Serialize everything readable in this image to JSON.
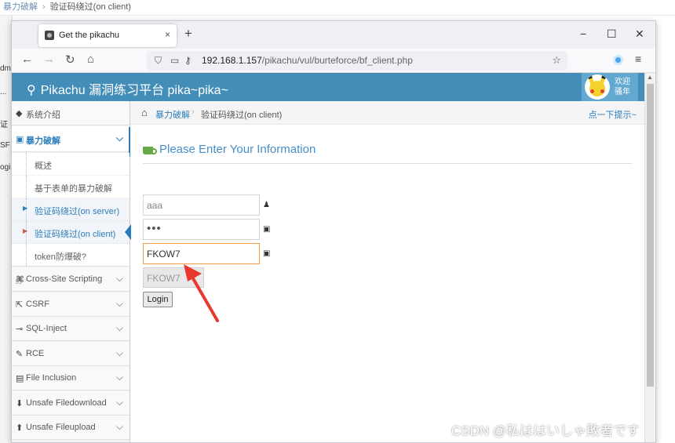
{
  "background_app": {
    "crumb_link": "暴力破解",
    "crumb_current": "验证码绕过(on client)",
    "left_fragments": [
      "dm",
      "...",
      "证",
      "SF",
      "ogi"
    ]
  },
  "browser": {
    "tab_title": "Get the pikachu",
    "tab_close": "×",
    "new_tab": "+",
    "window_controls": {
      "minimize": "−",
      "maximize": "☐",
      "close": "✕"
    },
    "nav": {
      "back": "←",
      "forward": "→",
      "reload": "↻",
      "home": "⌂"
    },
    "url_host": "192.168.1.157",
    "url_path": "/pikachu/vul/burteforce/bf_client.php",
    "star": "☆",
    "menu": "≡"
  },
  "page": {
    "brand": "Pikachu 漏洞练习平台 pika~pika~",
    "user_line1": "欢迎",
    "user_line2": "骚年",
    "sidebar": {
      "items": [
        {
          "icon": "tag-icon",
          "glyph": "🏷",
          "label": "系统介绍"
        },
        {
          "icon": "lock-icon",
          "glyph": "🔒",
          "label": "暴力破解",
          "chev": "⌵"
        },
        {
          "icon": "code-icon",
          "glyph": "⌘",
          "label": "Cross-Site Scripting",
          "chev": "⌵"
        },
        {
          "icon": "share-icon",
          "glyph": "⇱",
          "label": "CSRF",
          "chev": "⌵"
        },
        {
          "icon": "syringe-icon",
          "glyph": "⊸",
          "label": "SQL-Inject",
          "chev": "⌵"
        },
        {
          "icon": "pencil-icon",
          "glyph": "✎",
          "label": "RCE",
          "chev": "⌵"
        },
        {
          "icon": "file-icon",
          "glyph": "▤",
          "label": "File Inclusion",
          "chev": "⌵"
        },
        {
          "icon": "download-icon",
          "glyph": "⬇",
          "label": "Unsafe Filedownload",
          "chev": "⌵"
        },
        {
          "icon": "upload-icon",
          "glyph": "⬆",
          "label": "Unsafe Fileupload",
          "chev": "⌵"
        }
      ],
      "subitems": [
        "概述",
        "基于表单的暴力破解",
        "验证码绕过(on server)",
        "验证码绕过(on client)",
        "token防爆破?"
      ]
    },
    "breadcrumb": {
      "home_glyph": "⌂",
      "link": "暴力破解",
      "sep": "›",
      "current": "验证码绕过(on client)",
      "tip": "点一下提示~"
    },
    "form": {
      "title": "Please Enter Your Information",
      "username_value": "aaa",
      "password_value": "•••",
      "captcha_input_value": "FKOW7",
      "captcha_display": "FKOW7",
      "login_label": "Login",
      "user_glyph": "👤",
      "lock_glyph": "🔒"
    },
    "annotation_color": "#e8382f"
  },
  "watermark": "CSDN @私ははいしゃ敗者です",
  "colors": {
    "header": "#438eb9",
    "accent": "#2b7dbc",
    "focus_border": "#f59942"
  }
}
